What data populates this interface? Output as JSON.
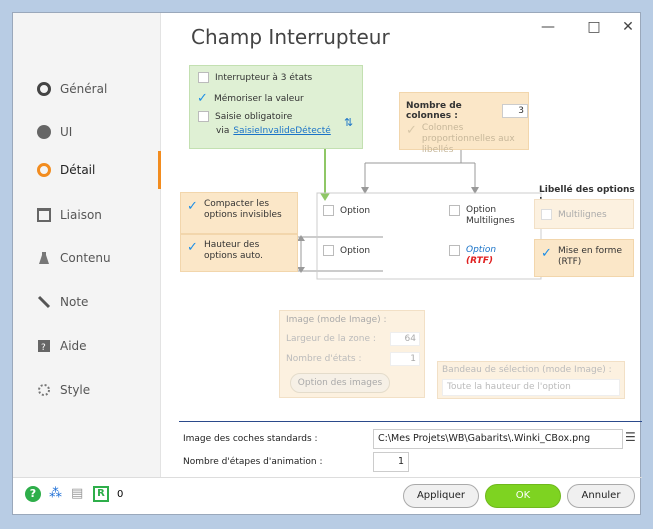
{
  "window": {
    "title": "Champ Interrupteur",
    "controls": [
      "—",
      "□",
      "✕"
    ]
  },
  "sidebar": {
    "items": [
      {
        "label": "Général",
        "icon": "circle-icon"
      },
      {
        "label": "UI",
        "icon": "ui-icon"
      },
      {
        "label": "Détail",
        "icon": "detail-icon",
        "active": true
      },
      {
        "label": "Liaison",
        "icon": "link-icon"
      },
      {
        "label": "Contenu",
        "icon": "content-icon"
      },
      {
        "label": "Note",
        "icon": "note-icon"
      },
      {
        "label": "Aide",
        "icon": "help-icon"
      },
      {
        "label": "Style",
        "icon": "style-icon"
      }
    ]
  },
  "green_box": {
    "opt1": "Interrupteur à 3 états",
    "opt2": "Mémoriser la valeur",
    "opt3": "Saisie obligatoire",
    "via": "via",
    "via_link": "SaisieInvalideDétecté"
  },
  "columns_box": {
    "label": "Nombre de colonnes :",
    "value": "3",
    "proportional": "Colonnes proportionnelles aux libellés"
  },
  "left_options": {
    "compact": "Compacter les options invisibles",
    "height": "Hauteur des options auto."
  },
  "preview": {
    "opt_a": "Option",
    "opt_b": "Option",
    "opt_c": "Option",
    "opt_c2": "Multilignes",
    "opt_d": "Option",
    "opt_d2": "(RTF)"
  },
  "label_options": {
    "title": "Libellé des options :",
    "multiline": "Multilignes",
    "format": "Mise en forme (RTF)"
  },
  "image_mode": {
    "title": "Image (mode Image) :",
    "width_label": "Largeur de la zone :",
    "width_value": "64",
    "states_label": "Nombre d'états :",
    "states_value": "1",
    "images_button": "Option des images",
    "band_label": "Bandeau de sélection (mode Image) :",
    "band_value": "Toute la hauteur de l'option"
  },
  "bottom_fields": {
    "check_images_label": "Image des coches standards :",
    "check_images_value": "C:\\Mes Projets\\WB\\Gabarits\\.Winki_CBox.png",
    "anim_label": "Nombre d'étapes d'animation :",
    "anim_value": "1"
  },
  "footer": {
    "apply": "Appliquer",
    "ok": "OK",
    "cancel": "Annuler",
    "count": "0"
  },
  "colors": {
    "accent": "#f28c1f",
    "ok_green": "#7ed321",
    "check_blue": "#1c8ee6",
    "rtf_red": "#e02020"
  }
}
